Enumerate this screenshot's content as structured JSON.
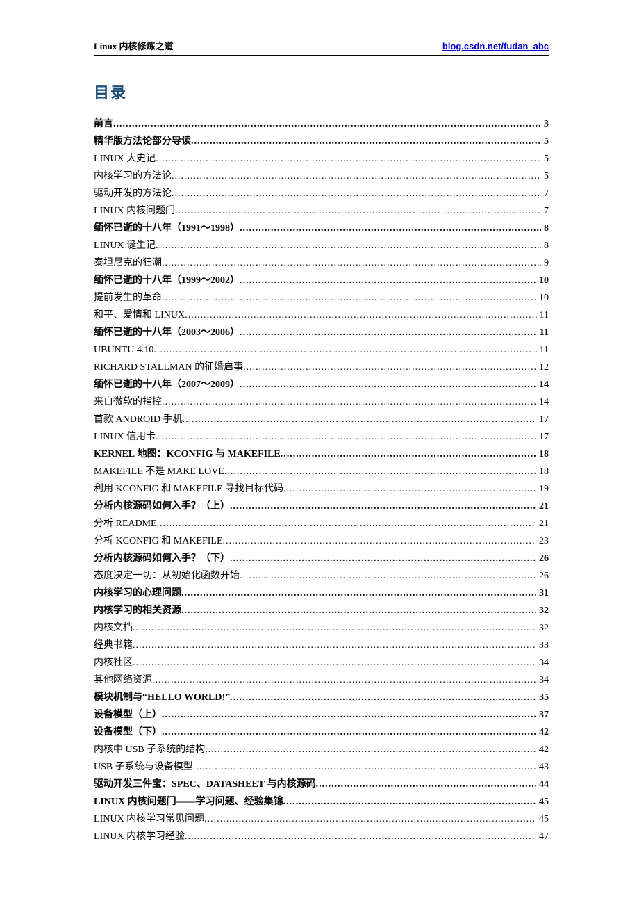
{
  "header": {
    "title": "Linux 内核修炼之道",
    "link_text": "blog.csdn.net/fudan_abc"
  },
  "toc": {
    "title": "目录",
    "entries": [
      {
        "label": "前言",
        "page": "3",
        "bold": true,
        "indent": 0
      },
      {
        "label": "精华版方法论部分导读",
        "page": "5",
        "bold": true,
        "indent": 0
      },
      {
        "label": "L<span class='sc'>INUX</span> 大史记",
        "page": "5",
        "bold": false,
        "indent": 1
      },
      {
        "label": "内核学习的方法论",
        "page": "5",
        "bold": false,
        "indent": 1
      },
      {
        "label": "驱动开发的方法论",
        "page": "7",
        "bold": false,
        "indent": 1
      },
      {
        "label": "L<span class='sc'>INUX</span> 内核问题门",
        "page": "7",
        "bold": false,
        "indent": 1
      },
      {
        "label": "缅怀已逝的十八年（1991～1998）",
        "page": "8",
        "bold": true,
        "indent": 0
      },
      {
        "label": "L<span class='sc'>INUX</span> 诞生记",
        "page": "8",
        "bold": false,
        "indent": 1
      },
      {
        "label": "泰坦尼克的狂潮",
        "page": "9",
        "bold": false,
        "indent": 1
      },
      {
        "label": "缅怀已逝的十八年（1999～2002）",
        "page": "10",
        "bold": true,
        "indent": 0
      },
      {
        "label": "提前发生的革命",
        "page": "10",
        "bold": false,
        "indent": 1
      },
      {
        "label": "和平、爱情和 L<span class='sc'>INUX</span>",
        "page": "11",
        "bold": false,
        "indent": 1
      },
      {
        "label": "缅怀已逝的十八年（2003～2006）",
        "page": "11",
        "bold": true,
        "indent": 0
      },
      {
        "label": "U<span class='sc'>BUNTU</span> 4.10",
        "page": "11",
        "bold": false,
        "indent": 1
      },
      {
        "label": "R<span class='sc'>ICHARD</span> S<span class='sc'>TALLMAN</span> 的征婚启事",
        "page": "12",
        "bold": false,
        "indent": 1
      },
      {
        "label": "缅怀已逝的十八年（2007～2009）",
        "page": "14",
        "bold": true,
        "indent": 0
      },
      {
        "label": "来自微软的指控",
        "page": "14",
        "bold": false,
        "indent": 1
      },
      {
        "label": "首款 A<span class='sc'>NDROID</span> 手机",
        "page": "17",
        "bold": false,
        "indent": 1
      },
      {
        "label": "L<span class='sc'>INUX</span> 信用卡",
        "page": "17",
        "bold": false,
        "indent": 1
      },
      {
        "label": "K<span class='sc'>ERNEL</span> 地图：K<span class='sc'>CONFIG</span> 与 M<span class='sc'>AKEFILE</span>",
        "page": "18",
        "bold": true,
        "indent": 0
      },
      {
        "label": "M<span class='sc'>AKEFILE</span> 不是 M<span class='sc'>AKE</span> L<span class='sc'>OVE</span>",
        "page": "18",
        "bold": false,
        "indent": 1
      },
      {
        "label": "利用 K<span class='sc'>CONFIG</span> 和 M<span class='sc'>AKEFILE</span> 寻找目标代码",
        "page": "19",
        "bold": false,
        "indent": 1
      },
      {
        "label": "分析内核源码如何入手？（上）",
        "page": "21",
        "bold": true,
        "indent": 0
      },
      {
        "label": "分析 README",
        "page": "21",
        "bold": false,
        "indent": 1
      },
      {
        "label": "分析 K<span class='sc'>CONFIG</span> 和 M<span class='sc'>AKEFILE</span>",
        "page": "23",
        "bold": false,
        "indent": 1
      },
      {
        "label": "分析内核源码如何入手？（下）",
        "page": "26",
        "bold": true,
        "indent": 0
      },
      {
        "label": "态度决定一切：从初始化函数开始",
        "page": "26",
        "bold": false,
        "indent": 1
      },
      {
        "label": "内核学习的心理问题",
        "page": "31",
        "bold": true,
        "indent": 0
      },
      {
        "label": "内核学习的相关资源",
        "page": "32",
        "bold": true,
        "indent": 0
      },
      {
        "label": "内核文档",
        "page": "32",
        "bold": false,
        "indent": 1
      },
      {
        "label": "经典书籍",
        "page": "33",
        "bold": false,
        "indent": 1
      },
      {
        "label": "内核社区",
        "page": "34",
        "bold": false,
        "indent": 1
      },
      {
        "label": "其他网络资源",
        "page": "34",
        "bold": false,
        "indent": 1
      },
      {
        "label": "模块机制与“H<span class='sc'>ELLO</span> W<span class='sc'>ORLD</span>!”",
        "page": "35",
        "bold": true,
        "indent": 0
      },
      {
        "label": "设备模型（上）",
        "page": "37",
        "bold": true,
        "indent": 0
      },
      {
        "label": "设备模型（下）",
        "page": "42",
        "bold": true,
        "indent": 0
      },
      {
        "label": "内核中 USB 子系统的结构",
        "page": "42",
        "bold": false,
        "indent": 1
      },
      {
        "label": "USB 子系统与设备模型",
        "page": "43",
        "bold": false,
        "indent": 1
      },
      {
        "label": "驱动开发三件宝：<span class='sc'>SPEC</span>、<span class='sc'>DATASHEET</span> 与内核源码",
        "page": "44",
        "bold": true,
        "indent": 0
      },
      {
        "label": "L<span class='sc'>INUX</span> 内核问题门——学习问题、经验集锦",
        "page": "45",
        "bold": true,
        "indent": 0
      },
      {
        "label": "L<span class='sc'>INUX</span> 内核学习常见问题",
        "page": "45",
        "bold": false,
        "indent": 1
      },
      {
        "label": "L<span class='sc'>INUX</span> 内核学习经验",
        "page": "47",
        "bold": false,
        "indent": 1
      }
    ]
  }
}
